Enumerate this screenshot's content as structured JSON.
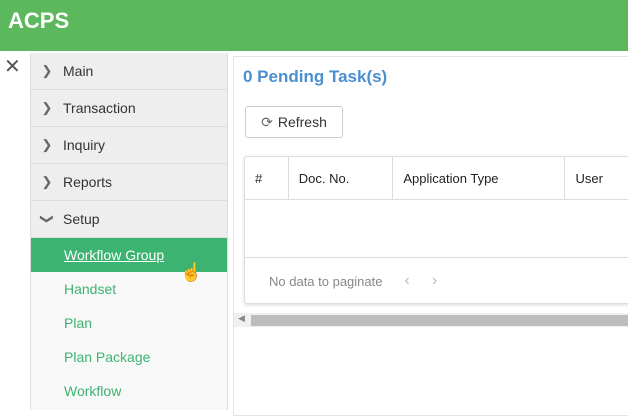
{
  "app": {
    "title": "ACPS"
  },
  "sidebar": {
    "menus": [
      {
        "label": "Main",
        "expanded": false
      },
      {
        "label": "Transaction",
        "expanded": false
      },
      {
        "label": "Inquiry",
        "expanded": false
      },
      {
        "label": "Reports",
        "expanded": false
      },
      {
        "label": "Setup",
        "expanded": true
      }
    ],
    "setup_items": [
      {
        "label": "Workflow Group",
        "active": true
      },
      {
        "label": "Handset"
      },
      {
        "label": "Plan"
      },
      {
        "label": "Plan Package"
      },
      {
        "label": "Workflow"
      }
    ]
  },
  "main": {
    "title": "0 Pending Task(s)",
    "refresh_label": "Refresh",
    "columns": [
      "#",
      "Doc. No.",
      "Application Type",
      "User"
    ],
    "pagination_text": "No data to paginate"
  },
  "colors": {
    "header": "#5cb85c",
    "active": "#3cb371",
    "title": "#4a8fd0"
  }
}
